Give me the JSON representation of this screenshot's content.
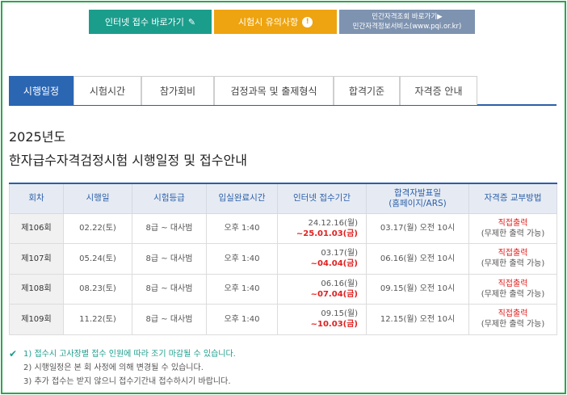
{
  "top_buttons": {
    "internet_apply": "인터넷 접수 바로가기",
    "cautions": "시험시 유의사항",
    "private_cert_line1": "민간자격조회 바로가기▶",
    "private_cert_line2": "민간자격정보서비스(www.pqi.or.kr)"
  },
  "tabs": [
    "시행일정",
    "시험시간",
    "참가회비",
    "검정과목 및 출제형식",
    "합격기준",
    "자격증 안내"
  ],
  "active_tab": 0,
  "heading": {
    "year": "2025년도",
    "title": "한자급수자격검정시험 시행일정 및 접수안내"
  },
  "table": {
    "headers": {
      "round": "회차",
      "date": "시행일",
      "grade": "시험등급",
      "entry": "입실완료시간",
      "period": "인터넷 접수기간",
      "result_line1": "합격자발표일",
      "result_line2": "(홈페이지/ARS)",
      "delivery": "자격증 교부방법"
    },
    "rows": [
      {
        "round": "제106회",
        "date": "02.22(토)",
        "grade": "8급 ~ 대사범",
        "entry": "오후 1:40",
        "period_start": "24.12.16(월)",
        "period_end": "~25.01.03(금)",
        "result": "03.17(월) 오전 10시",
        "delivery_main": "직접출력",
        "delivery_sub": "(무제한 출력 가능)"
      },
      {
        "round": "제107회",
        "date": "05.24(토)",
        "grade": "8급 ~ 대사범",
        "entry": "오후 1:40",
        "period_start": "03.17(월)",
        "period_end": "~04.04(금)",
        "result": "06.16(월) 오전 10시",
        "delivery_main": "직접출력",
        "delivery_sub": "(무제한 출력 가능)"
      },
      {
        "round": "제108회",
        "date": "08.23(토)",
        "grade": "8급 ~ 대사범",
        "entry": "오후 1:40",
        "period_start": "06.16(월)",
        "period_end": "~07.04(금)",
        "result": "09.15(월) 오전 10시",
        "delivery_main": "직접출력",
        "delivery_sub": "(무제한 출력 가능)"
      },
      {
        "round": "제109회",
        "date": "11.22(토)",
        "grade": "8급 ~ 대사범",
        "entry": "오후 1:40",
        "period_start": "09.15(월)",
        "period_end": "~10.03(금)",
        "result": "12.15(월) 오전 10시",
        "delivery_main": "직접출력",
        "delivery_sub": "(무제한 출력 가능)"
      }
    ]
  },
  "notes": [
    "1) 접수시 고사장별 접수 인원에 따라 조기 마감될 수 있습니다.",
    "2) 시행일정은 본 회 사정에 의해 변경될 수 있습니다.",
    "3) 추가 접수는 받지 않으니 접수기간내 접수하시기 바랍니다."
  ],
  "colors": {
    "frame": "#2ea44f",
    "teal": "#1b9d8c",
    "orange": "#eea410",
    "slate": "#7e93b0",
    "blue": "#2b66b3",
    "red": "#e02020"
  },
  "icons": {
    "pencil": "✎",
    "check": "✔",
    "exclamation": "!"
  }
}
